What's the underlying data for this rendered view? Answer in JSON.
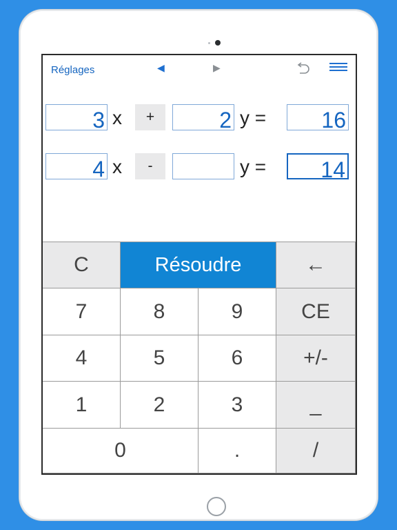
{
  "topbar": {
    "settings_label": "Réglages",
    "nav_prev_glyph": "◀",
    "nav_next_glyph": "▶"
  },
  "equations": [
    {
      "x_coef": "3",
      "x_var": "x",
      "operator": "+",
      "y_coef": "2",
      "y_var": "y =",
      "result": "16"
    },
    {
      "x_coef": "4",
      "x_var": "x",
      "operator": "-",
      "y_coef": "",
      "y_var": "y =",
      "result": "14"
    }
  ],
  "keypad": {
    "clear": "C",
    "solve": "Résoudre",
    "backspace": "←",
    "k7": "7",
    "k8": "8",
    "k9": "9",
    "ce": "CE",
    "k4": "4",
    "k5": "5",
    "k6": "6",
    "sign": "+/-",
    "k1": "1",
    "k2": "2",
    "k3": "3",
    "underscore": "_",
    "k0": "0",
    "dot": ".",
    "slash": "/"
  },
  "colors": {
    "background": "#2f8fe6",
    "accent": "#1565c0",
    "solve_button": "#1185d4",
    "gray_key": "#e9e9ea"
  }
}
